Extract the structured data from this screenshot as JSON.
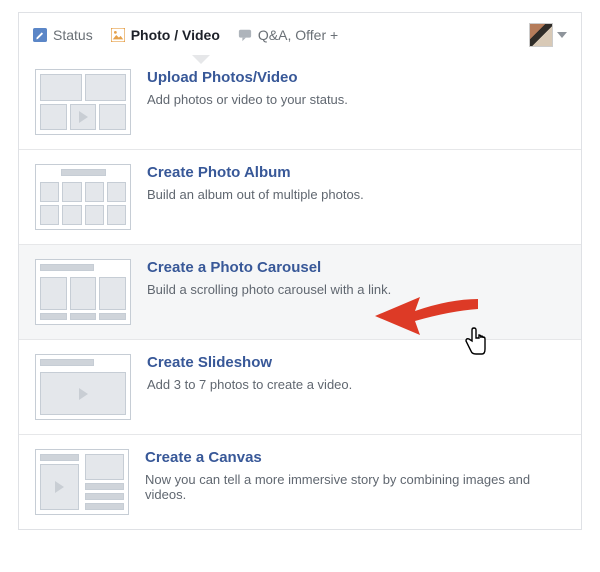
{
  "tabs": {
    "status": "Status",
    "photo_video": "Photo / Video",
    "qa_offer": "Q&A, Offer +"
  },
  "options": {
    "upload": {
      "title": "Upload Photos/Video",
      "desc": "Add photos or video to your status."
    },
    "album": {
      "title": "Create Photo Album",
      "desc": "Build an album out of multiple photos."
    },
    "carousel": {
      "title": "Create a Photo Carousel",
      "desc": "Build a scrolling photo carousel with a link."
    },
    "slideshow": {
      "title": "Create Slideshow",
      "desc": "Add 3 to 7 photos to create a video."
    },
    "canvas": {
      "title": "Create a Canvas",
      "desc": "Now you can tell a more immersive story by combining images and videos."
    }
  }
}
